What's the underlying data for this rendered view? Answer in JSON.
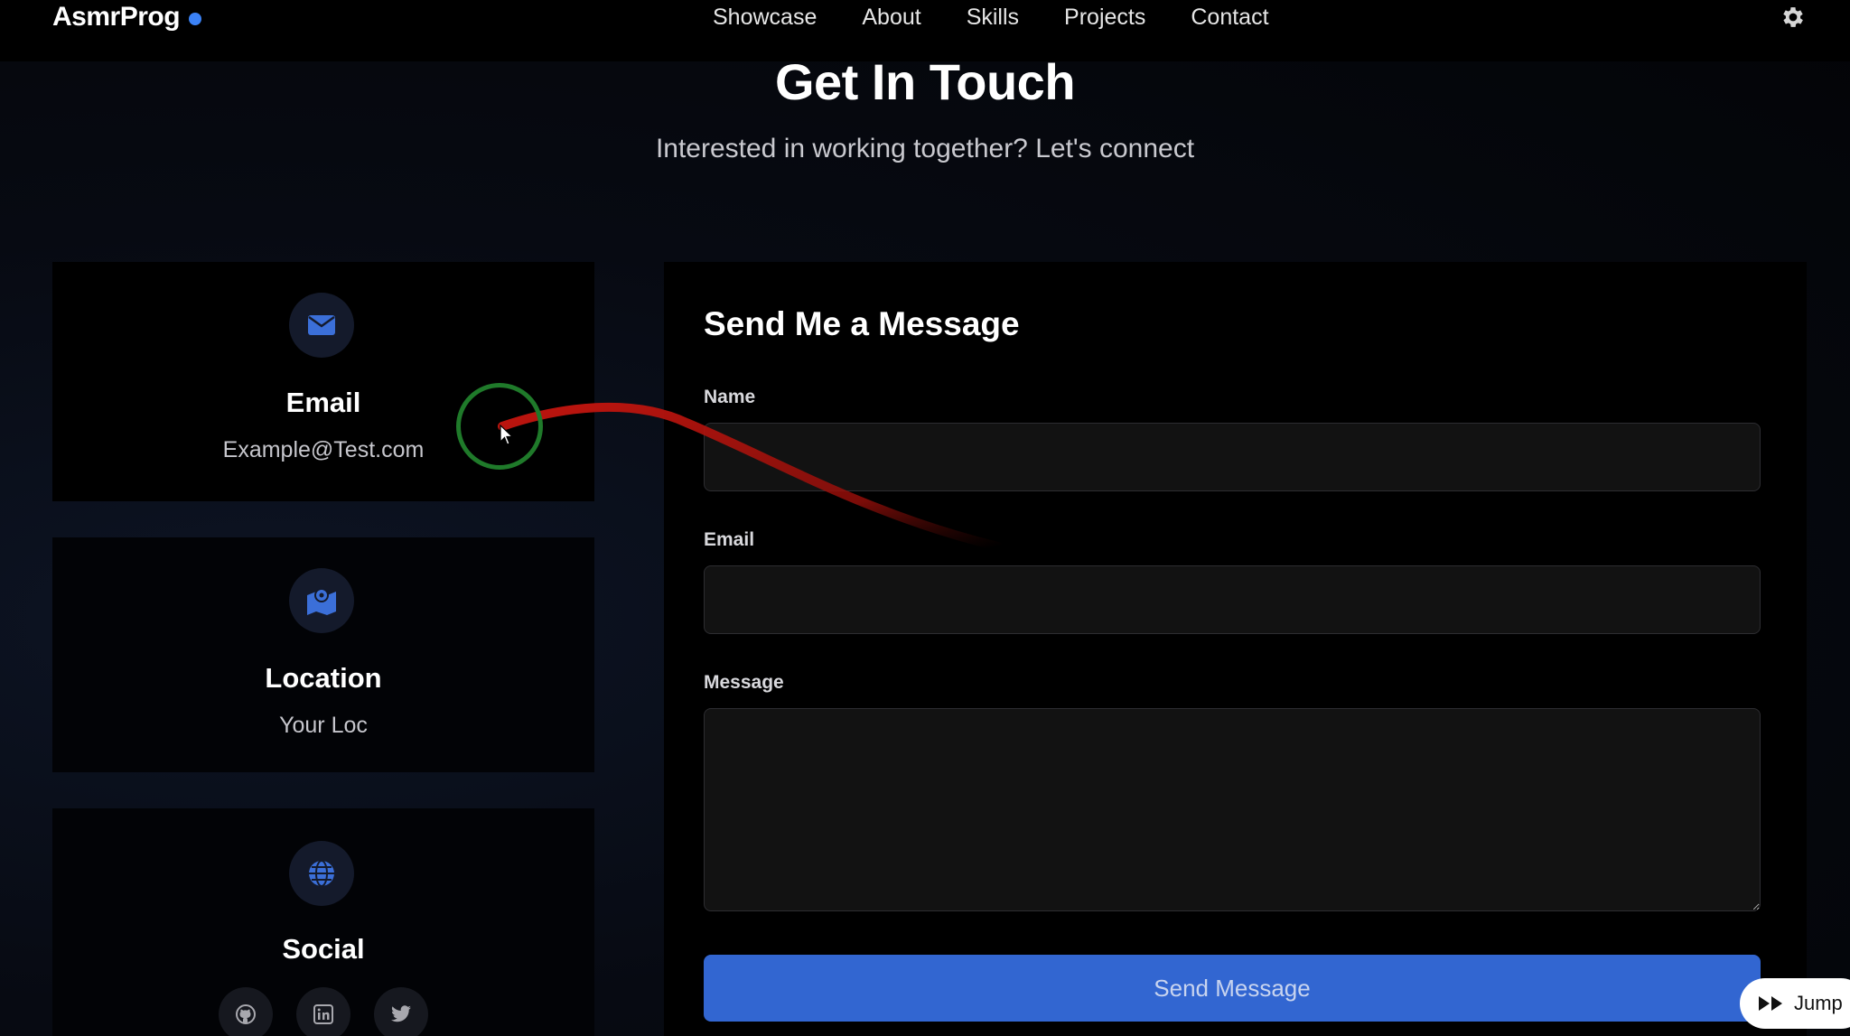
{
  "nav": {
    "brand": "AsmrProg",
    "links": [
      "Showcase",
      "About",
      "Skills",
      "Projects",
      "Contact"
    ],
    "settings_icon": "gear-icon"
  },
  "header": {
    "title": "Get In Touch",
    "subtitle": "Interested in working together? Let's connect"
  },
  "contact_info": {
    "email": {
      "icon": "envelope-icon",
      "title": "Email",
      "value": "Example@Test.com"
    },
    "location": {
      "icon": "map-icon",
      "title": "Location",
      "value": "Your Loc"
    },
    "social": {
      "icon": "globe-icon",
      "title": "Social",
      "links": [
        "github-icon",
        "linkedin-icon",
        "twitter-icon"
      ]
    }
  },
  "form": {
    "title": "Send Me a Message",
    "name_label": "Name",
    "name_value": "",
    "email_label": "Email",
    "email_value": "",
    "message_label": "Message",
    "message_value": "",
    "submit_label": "Send Message"
  },
  "overlay": {
    "jump_label": "Jump"
  },
  "colors": {
    "accent": "#3b82f6",
    "button": "#3266d1",
    "cursor_ring": "#1f7a2a",
    "annotation_stroke": "#c0150f"
  }
}
